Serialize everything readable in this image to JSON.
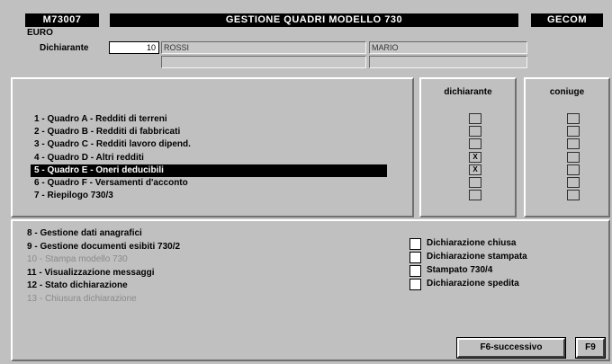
{
  "header": {
    "code": "M73007",
    "title": "GESTIONE QUADRI MODELLO 730",
    "app": "GECOM",
    "currency": "EURO"
  },
  "dichiarante": {
    "label": "Dichiarante",
    "number": "10",
    "surname": "ROSSI",
    "name": "MARIO",
    "line2_left": "",
    "line2_right": ""
  },
  "quadri": {
    "items": [
      {
        "label": "1 - Quadro A - Redditi di terreni"
      },
      {
        "label": "2 - Quadro B - Redditi di fabbricati"
      },
      {
        "label": "3 - Quadro C - Redditi lavoro dipend."
      },
      {
        "label": "4 - Quadro D - Altri redditi"
      },
      {
        "label": "5 - Quadro E - Oneri deducibili"
      },
      {
        "label": "6 - Quadro F - Versamenti d'acconto"
      },
      {
        "label": "7 - Riepilogo 730/3"
      }
    ],
    "selected_index": 4
  },
  "columns": {
    "dichiarante": "dichiarante",
    "coniuge": "coniuge",
    "dichiarante_marks": [
      "",
      "",
      "",
      "X",
      "X",
      "",
      ""
    ],
    "coniuge_marks": [
      "",
      "",
      "",
      "",
      "",
      "",
      ""
    ]
  },
  "options": [
    {
      "label": "8 - Gestione dati anagrafici",
      "enabled": true
    },
    {
      "label": "9 - Gestione documenti esibiti 730/2",
      "enabled": true
    },
    {
      "label": "10 - Stampa modello 730",
      "enabled": false
    },
    {
      "label": "11 - Visualizzazione messaggi",
      "enabled": true
    },
    {
      "label": "12 - Stato dichiarazione",
      "enabled": true
    },
    {
      "label": "13 - Chiusura dichiarazione",
      "enabled": false
    }
  ],
  "status_checks": [
    {
      "label": "Dichiarazione chiusa",
      "checked": false
    },
    {
      "label": "Dichiarazione stampata",
      "checked": false
    },
    {
      "label": "Stampato 730/4",
      "checked": false
    },
    {
      "label": "Dichiarazione spedita",
      "checked": false
    }
  ],
  "buttons": {
    "next": "F6-successivo",
    "f9": "F9"
  }
}
